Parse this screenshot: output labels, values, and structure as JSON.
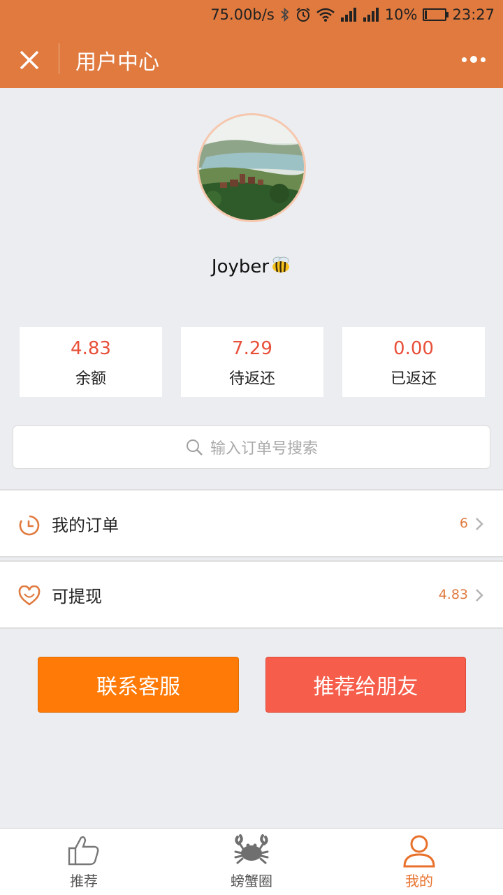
{
  "status_bar": {
    "speed": "75.00b/s",
    "battery_text": "10%",
    "battery_level": 0.1,
    "time": "23:27"
  },
  "header": {
    "title": "用户中心"
  },
  "profile": {
    "username": "Joyber"
  },
  "stats": [
    {
      "value": "4.83",
      "label": "余额"
    },
    {
      "value": "7.29",
      "label": "待返还"
    },
    {
      "value": "0.00",
      "label": "已返还"
    }
  ],
  "search": {
    "placeholder": "输入订单号搜索"
  },
  "menu": [
    {
      "label": "我的订单",
      "value": "6",
      "icon": "clock-icon"
    },
    {
      "label": "可提现",
      "value": "4.83",
      "icon": "heart-icon"
    }
  ],
  "buttons": {
    "contact": "联系客服",
    "recommend": "推荐给朋友"
  },
  "tabbar": [
    {
      "label": "推荐",
      "icon": "thumbs-up-icon",
      "active": false
    },
    {
      "label": "螃蟹圈",
      "icon": "crab-icon",
      "active": false
    },
    {
      "label": "我的",
      "icon": "user-icon",
      "active": true
    }
  ],
  "colors": {
    "header": "#e07a3f",
    "accent": "#e8503a",
    "button_orange": "#ff7a06",
    "button_red": "#f65d4a",
    "tab_active": "#e8712c"
  }
}
